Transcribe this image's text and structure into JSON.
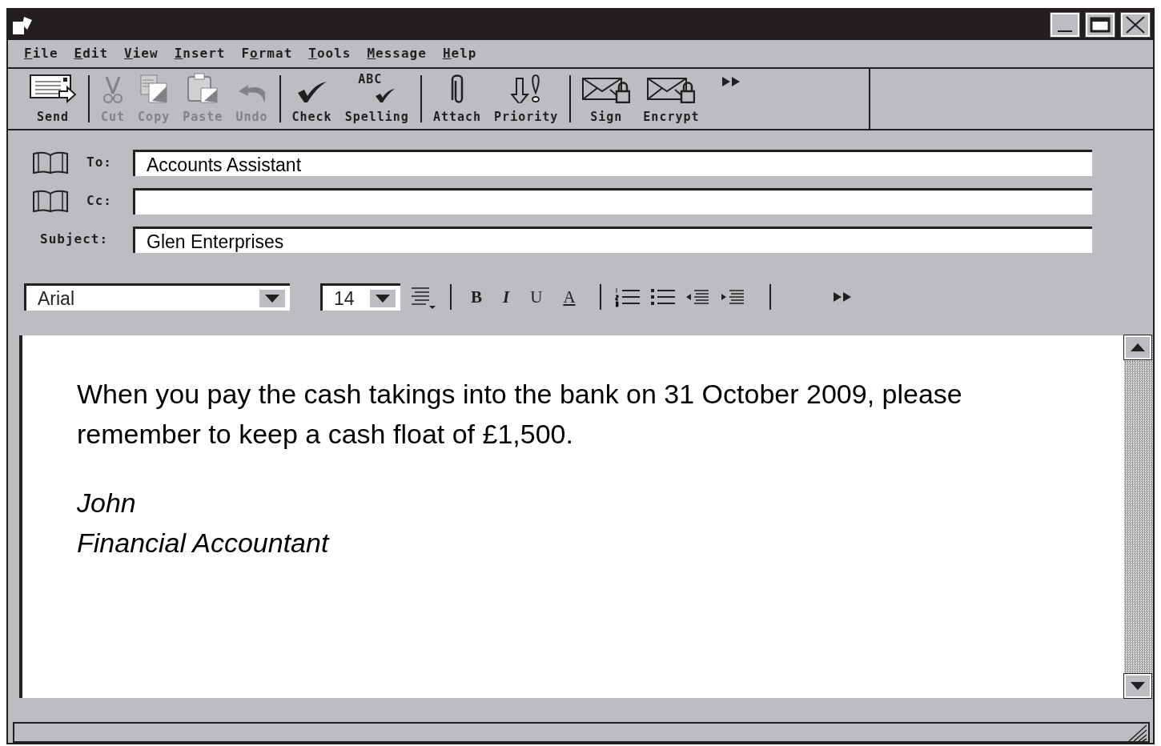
{
  "menus": [
    {
      "label": "File"
    },
    {
      "label": "Edit"
    },
    {
      "label": "View"
    },
    {
      "label": "Insert"
    },
    {
      "label": "Format"
    },
    {
      "label": "Tools"
    },
    {
      "label": "Message"
    },
    {
      "label": "Help"
    }
  ],
  "toolbar": [
    {
      "label": "Send",
      "disabled": false
    },
    {
      "label": "Cut",
      "disabled": true
    },
    {
      "label": "Copy",
      "disabled": true
    },
    {
      "label": "Paste",
      "disabled": true
    },
    {
      "label": "Undo",
      "disabled": true
    },
    {
      "label": "Check",
      "disabled": false
    },
    {
      "label": "Spelling",
      "disabled": false,
      "icon_text": "ABC"
    },
    {
      "label": "Attach",
      "disabled": false
    },
    {
      "label": "Priority",
      "disabled": false
    },
    {
      "label": "Sign",
      "disabled": false
    },
    {
      "label": "Encrypt",
      "disabled": false
    }
  ],
  "fields": [
    {
      "label": "To:",
      "value": "Accounts Assistant"
    },
    {
      "label": "Cc:"
    },
    {
      "label": "Subject:",
      "value": "Glen Enterprises"
    }
  ],
  "format_bar": {
    "font": "Arial",
    "size": "14",
    "bold": "B",
    "italic": "I",
    "underline": "U",
    "font_color": "A"
  },
  "body": {
    "paragraph": "When you pay the cash takings into the bank on 31 October 2009, please remember to keep a cash float of £1,500.",
    "signature": [
      "John",
      "Financial Accountant"
    ]
  }
}
